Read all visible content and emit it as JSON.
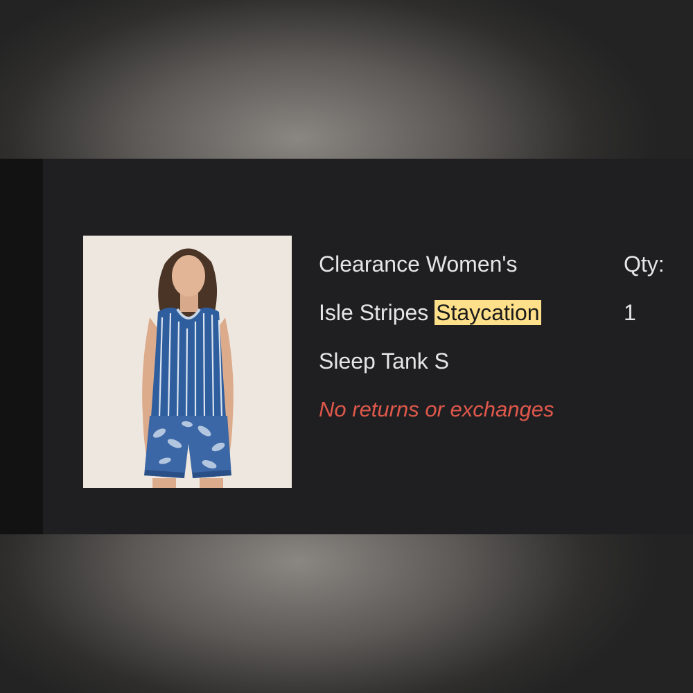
{
  "item": {
    "title_line1": "Clearance Women's",
    "title_line2_prefix": "Isle Stripes ",
    "title_line2_highlight": "Staycation",
    "title_line3": "Sleep Tank S",
    "notice": "No returns or exchanges",
    "qty_label": "Qty:",
    "qty_value": "1",
    "image_icon": "product-photo-woman-striped-tank"
  },
  "colors": {
    "panel": "#1f1f22",
    "text": "#e6e6e6",
    "notice": "#e0584b",
    "highlight": "#ffe08a"
  }
}
